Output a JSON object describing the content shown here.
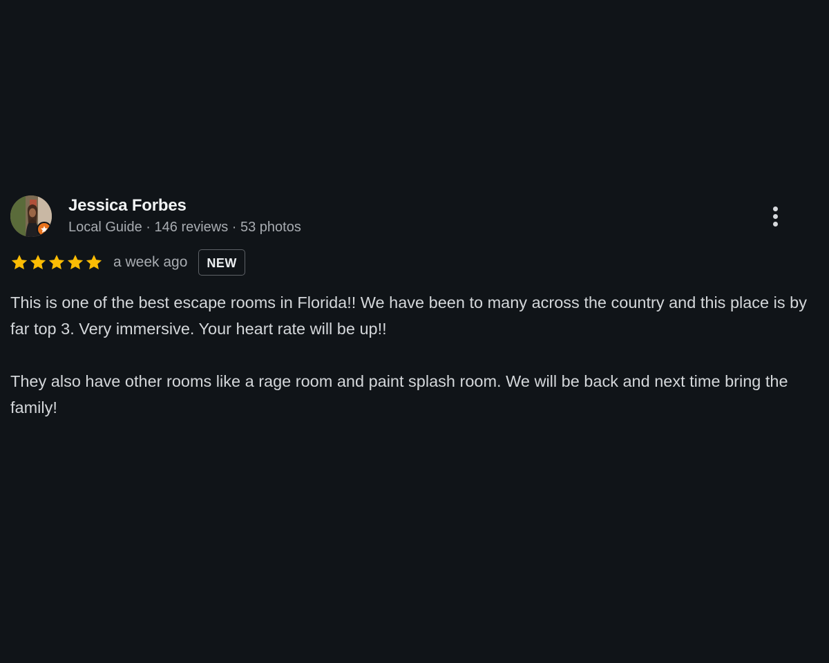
{
  "review": {
    "author": "Jessica Forbes",
    "meta": "Local Guide · 146 reviews · 53 photos",
    "rating": 5,
    "rating_max": 5,
    "time": "a week ago",
    "badge": "NEW",
    "paragraphs": [
      "This is one of the best escape rooms in Florida!! We have been to many across the country and this place is by far top 3. Very immersive. Your heart rate will be up!!",
      "They also have other rooms like a rage room and paint splash room. We will be back and next time bring the family!"
    ]
  },
  "icons": {
    "avatar": "user-photo",
    "guide_badge": "local-guide-star-icon",
    "more": "more-vert-icon",
    "star": "star-icon"
  },
  "colors": {
    "background": "#101418",
    "star": "#fbbc04",
    "guide_badge": "#e8721c"
  }
}
